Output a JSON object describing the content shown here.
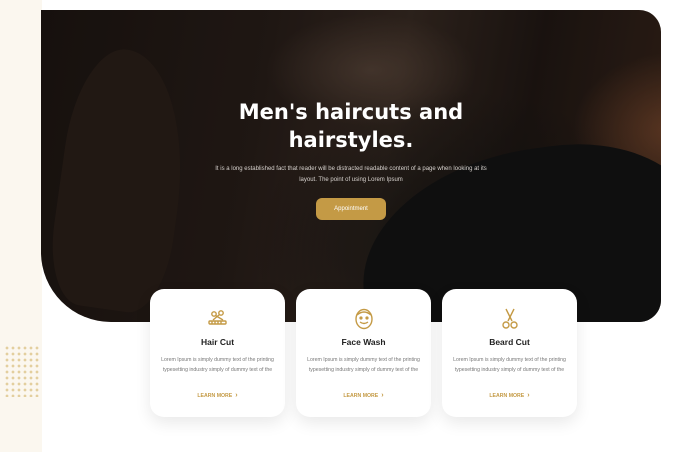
{
  "hero": {
    "title_line1": "Men's haircuts and",
    "title_line2": "hairstyles.",
    "description": "It is a long established fact that reader will be distracted readable content of a page when looking at its layout. The point of using Lorem Ipsum",
    "button_label": "Appointment"
  },
  "services": [
    {
      "icon": "comb-scissors-icon",
      "title": "Hair Cut",
      "description": "Lorem Ipsum is simply dummy text of the printing typesetting industry simply of dummy text of the",
      "link_label": "LEARN MORE",
      "link_arrow": "›"
    },
    {
      "icon": "face-wash-icon",
      "title": "Face Wash",
      "description": "Lorem Ipsum is simply dummy text of the printing typesetting industry simply of dummy text of the",
      "link_label": "LEARN MORE",
      "link_arrow": "›"
    },
    {
      "icon": "scissors-icon",
      "title": "Beard Cut",
      "description": "Lorem Ipsum is simply dummy text of the printing typesetting industry simply of dummy text of the",
      "link_label": "LEARN MORE",
      "link_arrow": "›"
    }
  ],
  "colors": {
    "accent": "#c49a45",
    "hero_bg": "#1e1612",
    "page_bg": "#ffffff",
    "decor_bg": "#fbf7ef"
  }
}
